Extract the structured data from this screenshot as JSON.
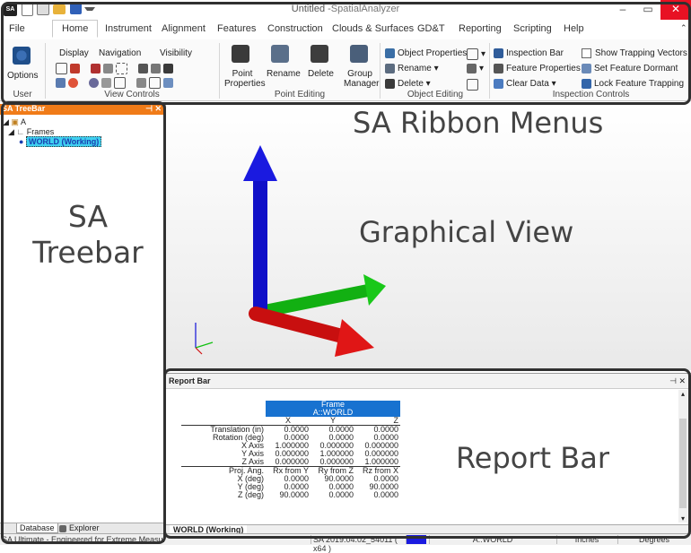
{
  "window": {
    "title_app": "Untitled",
    "title_suffix": "-SpatialAnalyzer",
    "minimize": "–",
    "maximize": "▭",
    "close": "✕"
  },
  "quick_access": {
    "logo": "SA"
  },
  "tabs": [
    "File",
    "Home",
    "Instrument",
    "Alignment",
    "Features",
    "Construction",
    "Clouds & Surfaces",
    "GD&T",
    "Reporting",
    "Scripting",
    "Help"
  ],
  "ribbon": {
    "user": {
      "options": "Options",
      "group": "User"
    },
    "view_controls": {
      "display": "Display",
      "navigation": "Navigation",
      "visibility": "Visibility",
      "group": "View Controls"
    },
    "point_editing": {
      "point_properties_1": "Point",
      "point_properties_2": "Properties",
      "rename": "Rename",
      "delete": "Delete",
      "group_manager_1": "Group",
      "group_manager_2": "Manager",
      "group": "Point Editing"
    },
    "object_editing": {
      "object_properties": "Object Properties",
      "rename": "Rename",
      "delete": "Delete",
      "group": "Object Editing"
    },
    "inspection_controls": {
      "inspection_bar": "Inspection Bar",
      "feature_properties": "Feature Properties",
      "clear_data": "Clear Data",
      "show_trapping": "Show Trapping Vectors",
      "set_dormant": "Set Feature Dormant",
      "lock_trapping": "Lock Feature Trapping",
      "group": "Inspection Controls"
    }
  },
  "treebar": {
    "title": "SA TreeBar",
    "pin": "⊣ ✕",
    "items": {
      "root": "A",
      "frames": "Frames",
      "world": "WORLD (Working)"
    },
    "tabs": {
      "database": "Database",
      "explorer": "Explorer"
    }
  },
  "report": {
    "title": "Report Bar",
    "header_frame": "Frame",
    "header_name": "A::WORLD",
    "cols": [
      "X",
      "Y",
      "Z"
    ],
    "rows": [
      {
        "label": "Translation (in)",
        "vals": [
          "0.0000",
          "0.0000",
          "0.0000"
        ]
      },
      {
        "label": "Rotation (deg)",
        "vals": [
          "0.0000",
          "0.0000",
          "0.0000"
        ]
      },
      {
        "label": "X Axis",
        "vals": [
          "1.000000",
          "0.000000",
          "0.000000"
        ]
      },
      {
        "label": "Y Axis",
        "vals": [
          "0.000000",
          "1.000000",
          "0.000000"
        ]
      },
      {
        "label": "Z Axis",
        "vals": [
          "0.000000",
          "0.000000",
          "1.000000"
        ]
      }
    ],
    "proj_header": {
      "label": "Proj. Ang.",
      "vals": [
        "Rx from Y",
        "Ry from Z",
        "Rz from X"
      ]
    },
    "proj_rows": [
      {
        "label": "X (deg)",
        "vals": [
          "0.0000",
          "90.0000",
          "0.0000"
        ]
      },
      {
        "label": "Y (deg)",
        "vals": [
          "0.0000",
          "0.0000",
          "90.0000"
        ]
      },
      {
        "label": "Z (deg)",
        "vals": [
          "90.0000",
          "0.0000",
          "0.0000"
        ]
      }
    ],
    "tab": "WORLD (Working)"
  },
  "statusbar": {
    "left": "SA Ultimate - Engineered for Extreme Measure",
    "version": "SA 2019.04.02_54011 ( x64 )",
    "frame": "A::WORLD",
    "units": "Inches",
    "angle": "Degrees"
  },
  "overlay": {
    "ribbon_menus": "SA Ribbon Menus",
    "graphical_view": "Graphical View",
    "treebar_1": "SA",
    "treebar_2": "Treebar",
    "report_bar": "Report Bar"
  },
  "colors": {
    "accent_orange": "#f07b18",
    "report_header_blue": "#1872d0",
    "axis_z": "#1010d8",
    "axis_x": "#d01010",
    "axis_y": "#10c010"
  }
}
